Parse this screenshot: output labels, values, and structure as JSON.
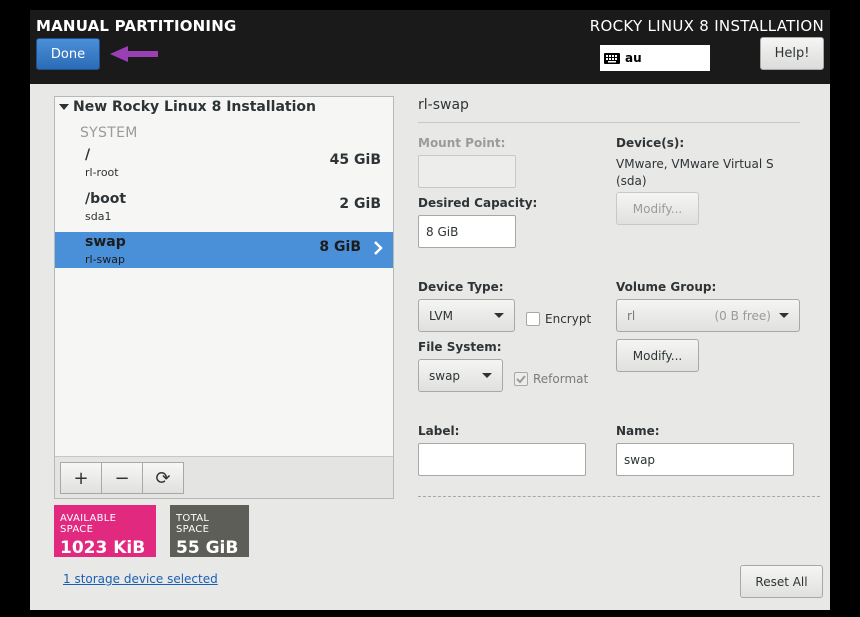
{
  "header": {
    "page_title": "MANUAL PARTITIONING",
    "product_title": "ROCKY LINUX 8 INSTALLATION",
    "done_label": "Done",
    "keyboard_layout": "au",
    "help_label": "Help!"
  },
  "left": {
    "install_title": "New Rocky Linux 8 Installation",
    "section_label": "SYSTEM",
    "mounts": [
      {
        "path": "/",
        "device": "rl-root",
        "size": "45 GiB"
      },
      {
        "path": "/boot",
        "device": "sda1",
        "size": "2 GiB"
      },
      {
        "path": "swap",
        "device": "rl-swap",
        "size": "8 GiB",
        "selected": true
      }
    ],
    "toolbar": {
      "add": "+",
      "remove": "−",
      "refresh": "⟳"
    },
    "available": {
      "label": "AVAILABLE SPACE",
      "value": "1023 KiB",
      "color": "#e0297f"
    },
    "total": {
      "label": "TOTAL SPACE",
      "value": "55 GiB",
      "color": "#5e5e59"
    },
    "storage_link": "1 storage device selected"
  },
  "details": {
    "title": "rl-swap",
    "mount_point_label": "Mount Point:",
    "mount_point_value": "",
    "desired_capacity_label": "Desired Capacity:",
    "desired_capacity_value": "8 GiB",
    "devices_label": "Device(s):",
    "devices_value": "VMware, VMware Virtual S (sda)",
    "modify_devices_label": "Modify...",
    "device_type_label": "Device Type:",
    "device_type_value": "LVM",
    "encrypt_label": "Encrypt",
    "volume_group_label": "Volume Group:",
    "volume_group_value": "rl",
    "volume_group_free": "(0 B free)",
    "modify_vg_label": "Modify...",
    "file_system_label": "File System:",
    "file_system_value": "swap",
    "reformat_label": "Reformat",
    "label_label": "Label:",
    "label_value": "",
    "name_label": "Name:",
    "name_value": "swap",
    "reset_label": "Reset All"
  },
  "colors": {
    "accent": "#4a90d9",
    "arrow": "#9b3fb5"
  }
}
